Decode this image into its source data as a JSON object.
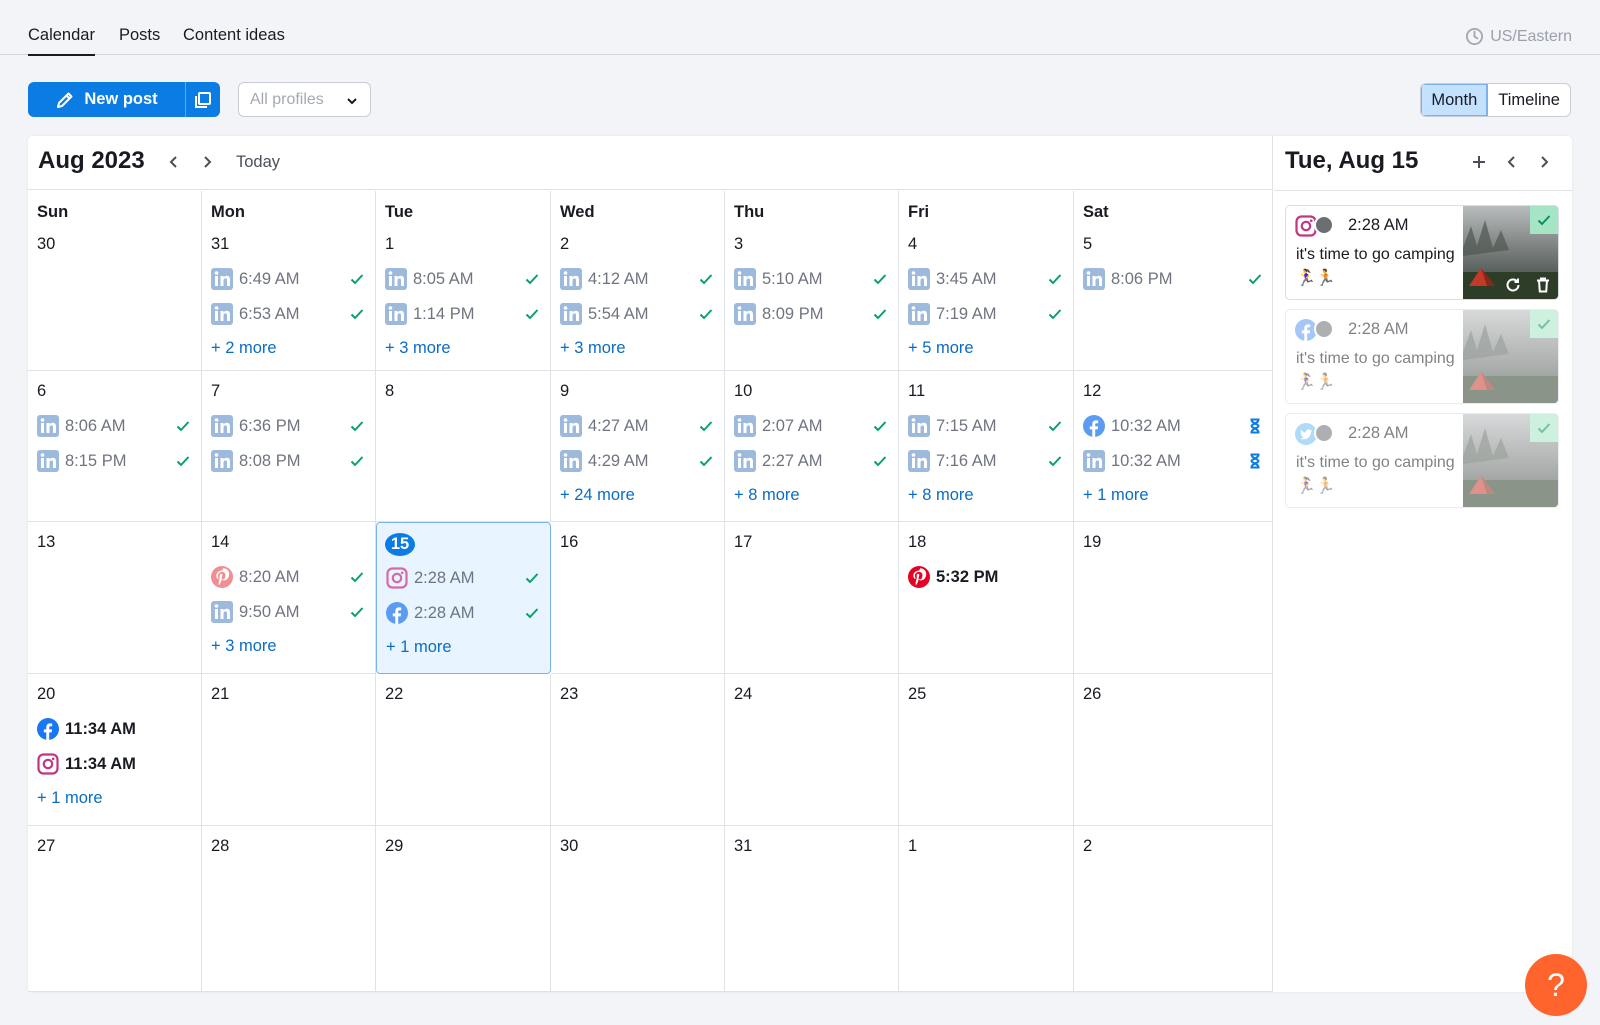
{
  "tabs": [
    {
      "label": "Calendar",
      "active": true
    },
    {
      "label": "Posts",
      "active": false
    },
    {
      "label": "Content ideas",
      "active": false
    }
  ],
  "timezone": "US/Eastern",
  "toolbar": {
    "new_post_label": "New post",
    "profile_filter": "All profiles",
    "view_modes": [
      "Month",
      "Timeline"
    ],
    "active_view": "Month"
  },
  "calendar": {
    "month_title": "Aug 2023",
    "today_label": "Today",
    "weekdays": [
      "Sun",
      "Mon",
      "Tue",
      "Wed",
      "Thu",
      "Fri",
      "Sat"
    ],
    "weeks": [
      [
        {
          "day": "30",
          "posts": [],
          "more": ""
        },
        {
          "day": "31",
          "posts": [
            {
              "icon": "linkedin",
              "time": "6:49 AM",
              "status": "check"
            },
            {
              "icon": "linkedin",
              "time": "6:53 AM",
              "status": "check"
            }
          ],
          "more": "+ 2 more"
        },
        {
          "day": "1",
          "posts": [
            {
              "icon": "linkedin",
              "time": "8:05 AM",
              "status": "check"
            },
            {
              "icon": "linkedin",
              "time": "1:14 PM",
              "status": "check"
            }
          ],
          "more": "+ 3 more"
        },
        {
          "day": "2",
          "posts": [
            {
              "icon": "linkedin",
              "time": "4:12 AM",
              "status": "check"
            },
            {
              "icon": "linkedin",
              "time": "5:54 AM",
              "status": "check"
            }
          ],
          "more": "+ 3 more"
        },
        {
          "day": "3",
          "posts": [
            {
              "icon": "linkedin",
              "time": "5:10 AM",
              "status": "check"
            },
            {
              "icon": "linkedin",
              "time": "8:09 PM",
              "status": "check"
            }
          ],
          "more": ""
        },
        {
          "day": "4",
          "posts": [
            {
              "icon": "linkedin",
              "time": "3:45 AM",
              "status": "check"
            },
            {
              "icon": "linkedin",
              "time": "7:19 AM",
              "status": "check"
            }
          ],
          "more": "+ 5 more"
        },
        {
          "day": "5",
          "posts": [
            {
              "icon": "linkedin",
              "time": "8:06 PM",
              "status": "check"
            }
          ],
          "more": ""
        }
      ],
      [
        {
          "day": "6",
          "posts": [
            {
              "icon": "linkedin",
              "time": "8:06 AM",
              "status": "check"
            },
            {
              "icon": "linkedin",
              "time": "8:15 PM",
              "status": "check"
            }
          ],
          "more": ""
        },
        {
          "day": "7",
          "posts": [
            {
              "icon": "linkedin",
              "time": "6:36 PM",
              "status": "check"
            },
            {
              "icon": "linkedin",
              "time": "8:08 PM",
              "status": "check"
            }
          ],
          "more": ""
        },
        {
          "day": "8",
          "posts": [],
          "more": ""
        },
        {
          "day": "9",
          "posts": [
            {
              "icon": "linkedin",
              "time": "4:27 AM",
              "status": "check"
            },
            {
              "icon": "linkedin",
              "time": "4:29 AM",
              "status": "check"
            }
          ],
          "more": "+ 24 more"
        },
        {
          "day": "10",
          "posts": [
            {
              "icon": "linkedin",
              "time": "2:07 AM",
              "status": "check"
            },
            {
              "icon": "linkedin",
              "time": "2:27 AM",
              "status": "check"
            }
          ],
          "more": "+ 8 more"
        },
        {
          "day": "11",
          "posts": [
            {
              "icon": "linkedin",
              "time": "7:15 AM",
              "status": "check"
            },
            {
              "icon": "linkedin",
              "time": "7:16 AM",
              "status": "check"
            }
          ],
          "more": "+ 8 more"
        },
        {
          "day": "12",
          "posts": [
            {
              "icon": "facebook",
              "time": "10:32 AM",
              "status": "pending"
            },
            {
              "icon": "linkedin",
              "time": "10:32 AM",
              "status": "pending"
            }
          ],
          "more": "+ 1 more"
        }
      ],
      [
        {
          "day": "13",
          "posts": [],
          "more": ""
        },
        {
          "day": "14",
          "posts": [
            {
              "icon": "pinterest",
              "time": "8:20 AM",
              "status": "check"
            },
            {
              "icon": "linkedin",
              "time": "9:50 AM",
              "status": "check"
            }
          ],
          "more": "+ 3 more"
        },
        {
          "day": "15",
          "selected": true,
          "posts": [
            {
              "icon": "instagram",
              "time": "2:28 AM",
              "status": "check"
            },
            {
              "icon": "facebook",
              "time": "2:28 AM",
              "status": "check"
            }
          ],
          "more": "+ 1 more"
        },
        {
          "day": "16",
          "posts": [],
          "more": ""
        },
        {
          "day": "17",
          "posts": [],
          "more": ""
        },
        {
          "day": "18",
          "posts": [
            {
              "icon": "pinterest",
              "time": "5:32 PM",
              "status": "scheduled"
            }
          ],
          "more": ""
        },
        {
          "day": "19",
          "posts": [],
          "more": ""
        }
      ],
      [
        {
          "day": "20",
          "posts": [
            {
              "icon": "facebook",
              "time": "11:34 AM",
              "status": "scheduled"
            },
            {
              "icon": "instagram",
              "time": "11:34 AM",
              "status": "scheduled"
            }
          ],
          "more": "+ 1 more"
        },
        {
          "day": "21",
          "posts": [],
          "more": ""
        },
        {
          "day": "22",
          "posts": [],
          "more": ""
        },
        {
          "day": "23",
          "posts": [],
          "more": ""
        },
        {
          "day": "24",
          "posts": [],
          "more": ""
        },
        {
          "day": "25",
          "posts": [],
          "more": ""
        },
        {
          "day": "26",
          "posts": [],
          "more": ""
        }
      ],
      [
        {
          "day": "27",
          "posts": [],
          "more": ""
        },
        {
          "day": "28",
          "posts": [],
          "more": ""
        },
        {
          "day": "29",
          "posts": [],
          "more": ""
        },
        {
          "day": "30",
          "posts": [],
          "more": ""
        },
        {
          "day": "31",
          "posts": [],
          "more": ""
        },
        {
          "day": "1",
          "posts": [],
          "more": ""
        },
        {
          "day": "2",
          "posts": [],
          "more": ""
        }
      ]
    ]
  },
  "side_panel": {
    "title": "Tue, Aug 15",
    "cards": [
      {
        "network": "instagram",
        "time": "2:28 AM",
        "text": "it's time to go camping 🏃‍♀️🏃",
        "image": "tent-in-fog",
        "faded": false
      },
      {
        "network": "facebook",
        "time": "2:28 AM",
        "text": "it's time to go camping 🏃‍♀️🏃",
        "image": "tent-in-fog",
        "faded": true
      },
      {
        "network": "twitter",
        "time": "2:28 AM",
        "text": "it's time to go camping 🏃‍♀️🏃",
        "image": "tent-in-fog",
        "faded": true
      }
    ]
  },
  "help_label": "?",
  "colors": {
    "accent": "#0a7ce4",
    "check": "#0aa069",
    "pending": "#0a7ce4",
    "help": "#ff642d",
    "selected_bg": "#e8f4ff"
  }
}
